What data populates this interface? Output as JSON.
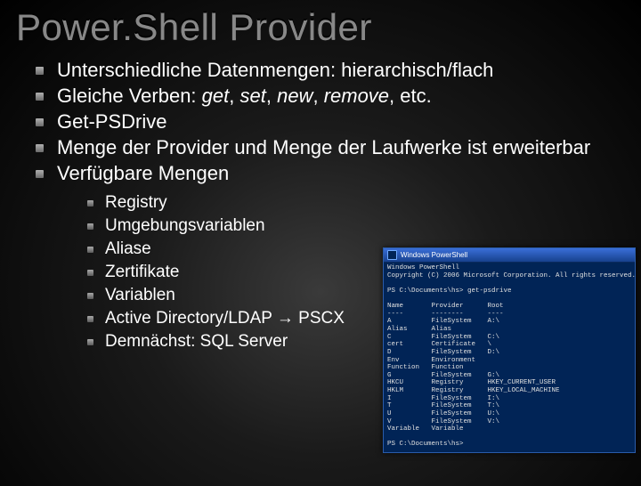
{
  "title": "Power.Shell Provider",
  "bullets": {
    "b1": "Unterschiedliche Datenmengen: hierarchisch/flach",
    "b2_prefix": "Gleiche Verben: ",
    "b2_verbs": [
      "get",
      "set",
      "new",
      "remove"
    ],
    "b2_suffix": ", etc.",
    "b3": "Get-PSDrive",
    "b4": "Menge der Provider und Menge der Laufwerke ist erweiterbar",
    "b5": "Verfügbare Mengen"
  },
  "sub": {
    "s1": "Registry",
    "s2": "Umgebungsvariablen",
    "s3": "Aliase",
    "s4": "Zertifikate",
    "s5": "Variablen",
    "s6": "Active Directory/LDAP → PSCX",
    "s7": "Demnächst: SQL Server"
  },
  "ps": {
    "title": "Windows PowerShell",
    "banner1": "Windows PowerShell",
    "banner2": "Copyright (C) 2006 Microsoft Corporation. All rights reserved.",
    "prompt1": "PS C:\\Documents\\hs> get-psdrive",
    "header": "Name       Provider      Root",
    "rule": "----       --------      ----",
    "rows": [
      "A          FileSystem    A:\\",
      "Alias      Alias",
      "C          FileSystem    C:\\",
      "cert       Certificate   \\",
      "D          FileSystem    D:\\",
      "Env        Environment",
      "Function   Function",
      "G          FileSystem    G:\\",
      "HKCU       Registry      HKEY_CURRENT_USER",
      "HKLM       Registry      HKEY_LOCAL_MACHINE",
      "I          FileSystem    I:\\",
      "T          FileSystem    T:\\",
      "U          FileSystem    U:\\",
      "V          FileSystem    V:\\",
      "Variable   Variable"
    ],
    "prompt2": "PS C:\\Documents\\hs>"
  }
}
